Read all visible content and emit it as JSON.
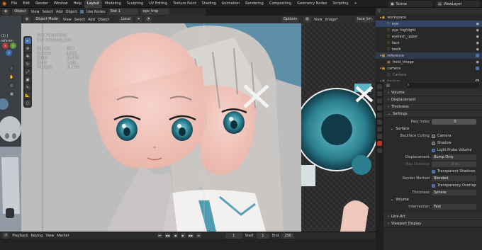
{
  "app": {
    "menu": [
      "File",
      "Edit",
      "Render",
      "Window",
      "Help"
    ],
    "workspaces": [
      "Layout",
      "Modeling",
      "Sculpting",
      "UV Editing",
      "Texture Paint",
      "Shading",
      "Animation",
      "Rendering",
      "Compositing",
      "Geometry Nodes",
      "Scripting"
    ],
    "scene": "Scene",
    "view_layer": "ViewLayer"
  },
  "viewport_header": {
    "mode": "Object",
    "menus": [
      "View",
      "Select",
      "Add",
      "Object"
    ],
    "use_nodes": "Use Nodes",
    "slot": "Slot 1",
    "material": "eye_tmp"
  },
  "viewport2_header": {
    "mode": "Object Mode",
    "menus": [
      "View",
      "Select",
      "Add",
      "Object"
    ],
    "orientation": "Local",
    "options": "Options"
  },
  "image_editor_header": {
    "menus": [
      "View",
      "Image*"
    ],
    "image": "face_tm"
  },
  "viewport_overlay": {
    "lines": [
      "User Perspective",
      "(1) | reference_face",
      "Objects",
      "Vertices",
      "Edges",
      "Faces",
      "Triangles"
    ],
    "values": [
      "",
      "",
      "0/11",
      "8,952",
      "15,936",
      "7,084",
      "14,168"
    ],
    "left_label": "(1) | referen"
  },
  "outliner": {
    "rows": [
      {
        "label": "workspace",
        "sel": false
      },
      {
        "label": "eye",
        "sel": true
      },
      {
        "label": "eye_highlight",
        "sel": false
      },
      {
        "label": "eyelash_upper",
        "sel": false
      },
      {
        "label": "face",
        "sel": false
      },
      {
        "label": "teeth",
        "sel": false
      },
      {
        "label": "reference",
        "sel": false
      },
      {
        "label": "front_image",
        "sel": false
      },
      {
        "label": "camera",
        "sel": false
      },
      {
        "label": "Camera",
        "sel": false
      },
      {
        "label": "backup",
        "sel": false
      }
    ]
  },
  "properties": {
    "search_placeholder": "",
    "panels_top": [
      "Volume",
      "Displacement",
      "Thickness",
      "Settings"
    ],
    "pass_index_label": "Pass Index",
    "pass_index_value": "0",
    "surface_label": "Surface",
    "backface_label": "Backface Culling",
    "backface_opts": [
      "Camera",
      "Shadow",
      "Light Probe Volume"
    ],
    "backface_checked": [
      false,
      false,
      true
    ],
    "displacement_label": "Displacement",
    "displacement_value": "Bump Only",
    "maxdist_label": "Max Distance",
    "maxdist_value": "0 m",
    "transparent_shadows": "Transparent Shadows",
    "render_method_label": "Render Method",
    "render_method_value": "Blended",
    "transparency_overlap": "Transparency Overlap",
    "thickness_label": "Thickness",
    "thickness_value": "Sphere",
    "volume_label": "Volume",
    "intersection_label": "Intersection",
    "intersection_value": "Fast",
    "panels_bottom": [
      "Line Art",
      "Viewport Display"
    ]
  },
  "timeline": {
    "menus": [
      "Playback",
      "Keying",
      "View",
      "Marker"
    ],
    "current_frame": "1",
    "start_label": "Start",
    "start": "1",
    "end_label": "End",
    "end": "250"
  },
  "colors": {
    "accent": "#4772b3",
    "skin": "#f3c7bd",
    "eye": "#2b7f8f",
    "hair": "#c9c6c4"
  }
}
